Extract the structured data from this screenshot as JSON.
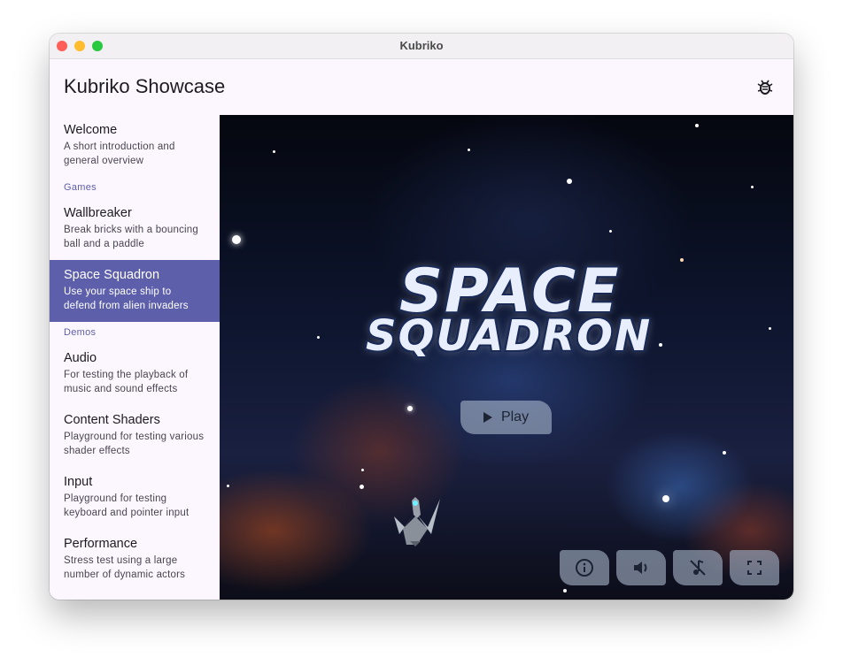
{
  "window": {
    "title": "Kubriko"
  },
  "appbar": {
    "title": "Kubriko Showcase"
  },
  "sidebar": {
    "welcome": {
      "title": "Welcome",
      "desc": "A short introduction and general overview"
    },
    "games_header": "Games",
    "games": [
      {
        "title": "Wallbreaker",
        "desc": "Break bricks with a bouncing ball and a paddle"
      },
      {
        "title": "Space Squadron",
        "desc": "Use your space ship to defend from alien invaders"
      }
    ],
    "demos_header": "Demos",
    "demos": [
      {
        "title": "Audio",
        "desc": "For testing the playback of music and sound effects"
      },
      {
        "title": "Content Shaders",
        "desc": "Playground for testing various shader effects"
      },
      {
        "title": "Input",
        "desc": "Playground for testing keyboard and pointer input"
      },
      {
        "title": "Performance",
        "desc": "Stress test using a large number of dynamic actors"
      }
    ]
  },
  "game": {
    "logo_line1": "SPACE",
    "logo_line2": "SQUADRON",
    "play_label": "Play",
    "controls": [
      "info-icon",
      "volume-icon",
      "music-off-icon",
      "fullscreen-icon"
    ]
  },
  "colors": {
    "selected": "#5d5fab",
    "section_header": "#5d5fab",
    "background": "#fcf7ff"
  }
}
